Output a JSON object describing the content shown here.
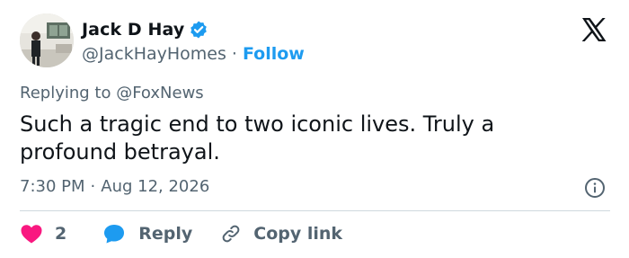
{
  "author": {
    "display_name": "Jack D Hay",
    "handle": "@JackHayHomes",
    "follow_label": "Follow",
    "separator": "·",
    "verified": true
  },
  "reply_context": {
    "prefix": "Replying to",
    "mention": "@FoxNews"
  },
  "tweet": {
    "text": "Such a tragic end to two iconic lives. Truly a profound betrayal.",
    "time": "7:30 PM",
    "date": "Aug 12, 2026",
    "separator": "·"
  },
  "actions": {
    "like_count": "2",
    "reply_label": "Reply",
    "copy_link_label": "Copy link"
  },
  "colors": {
    "link_blue": "#1d9bf0",
    "like_red": "#f91880",
    "muted": "#536471",
    "text": "#0f1419"
  },
  "icons": {
    "brand": "x-logo-icon",
    "verified": "verified-badge-icon",
    "info": "info-icon",
    "like": "heart-icon",
    "reply": "speech-bubble-icon",
    "copy": "link-icon"
  }
}
